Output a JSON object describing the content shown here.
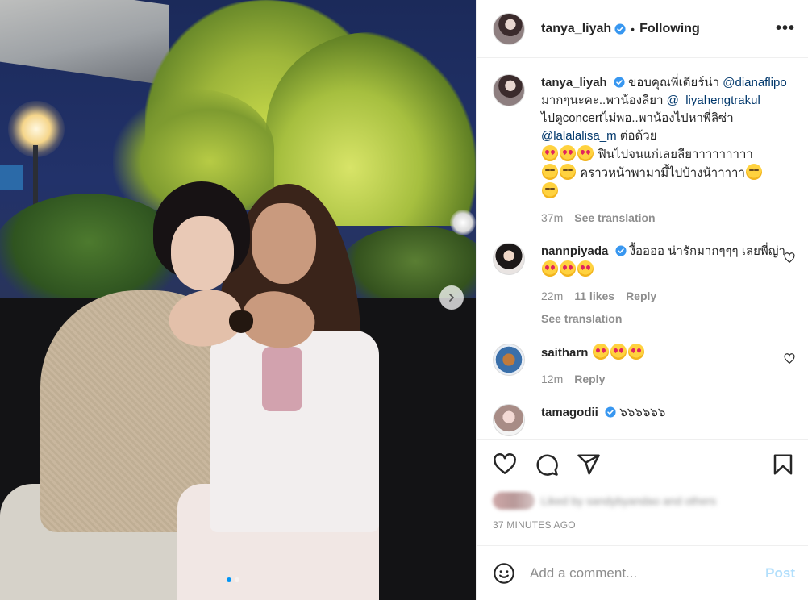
{
  "post": {
    "username": "tanya_liyah",
    "follow_state": "Following",
    "more_label": "•••"
  },
  "caption": {
    "username": "tanya_liyah",
    "text_1": "ขอบคุณพี่เดียร์น่า ",
    "mention_1": "@dianaflipo",
    "text_2": " มากๆนะคะ..พาน้องลียา ",
    "mention_2": "@_liyahengtrakul",
    "text_3": " ไปดูconcertไม่พอ..พาน้องไปหาพี่ลิซ่า ",
    "mention_3": "@lalalalisa_m",
    "text_4": " ต่อด้วย",
    "text_5": " ฟินไปจนแก่เลยลียาาาาาาาาา",
    "text_6": " คราวหน้าพามามี้ไปบ้างน้าาาาา",
    "time": "37m",
    "see_translation": "See translation"
  },
  "comments": [
    {
      "username": "nannpiyada",
      "text": " งื้ออออ น่ารักมากๆๆๆ เลยพี่ญ่า",
      "time": "22m",
      "likes": "11 likes",
      "reply": "Reply",
      "see_translation": "See translation"
    },
    {
      "username": "saitharn",
      "time": "12m",
      "reply": "Reply"
    },
    {
      "username": "tamagodii",
      "text": " ๖๖๖๖๖๖"
    }
  ],
  "likes": {
    "text": "Liked by sandybyandao and others"
  },
  "timestamp": "37 MINUTES AGO",
  "comment_box": {
    "placeholder": "Add a comment...",
    "post_label": "Post"
  },
  "colors": {
    "verified": "#3897f0",
    "mention": "#00376b",
    "post_button": "#b2dffc",
    "active_dot": "#0095f6"
  },
  "carousel": {
    "slide_count": 2,
    "active_index": 0
  }
}
